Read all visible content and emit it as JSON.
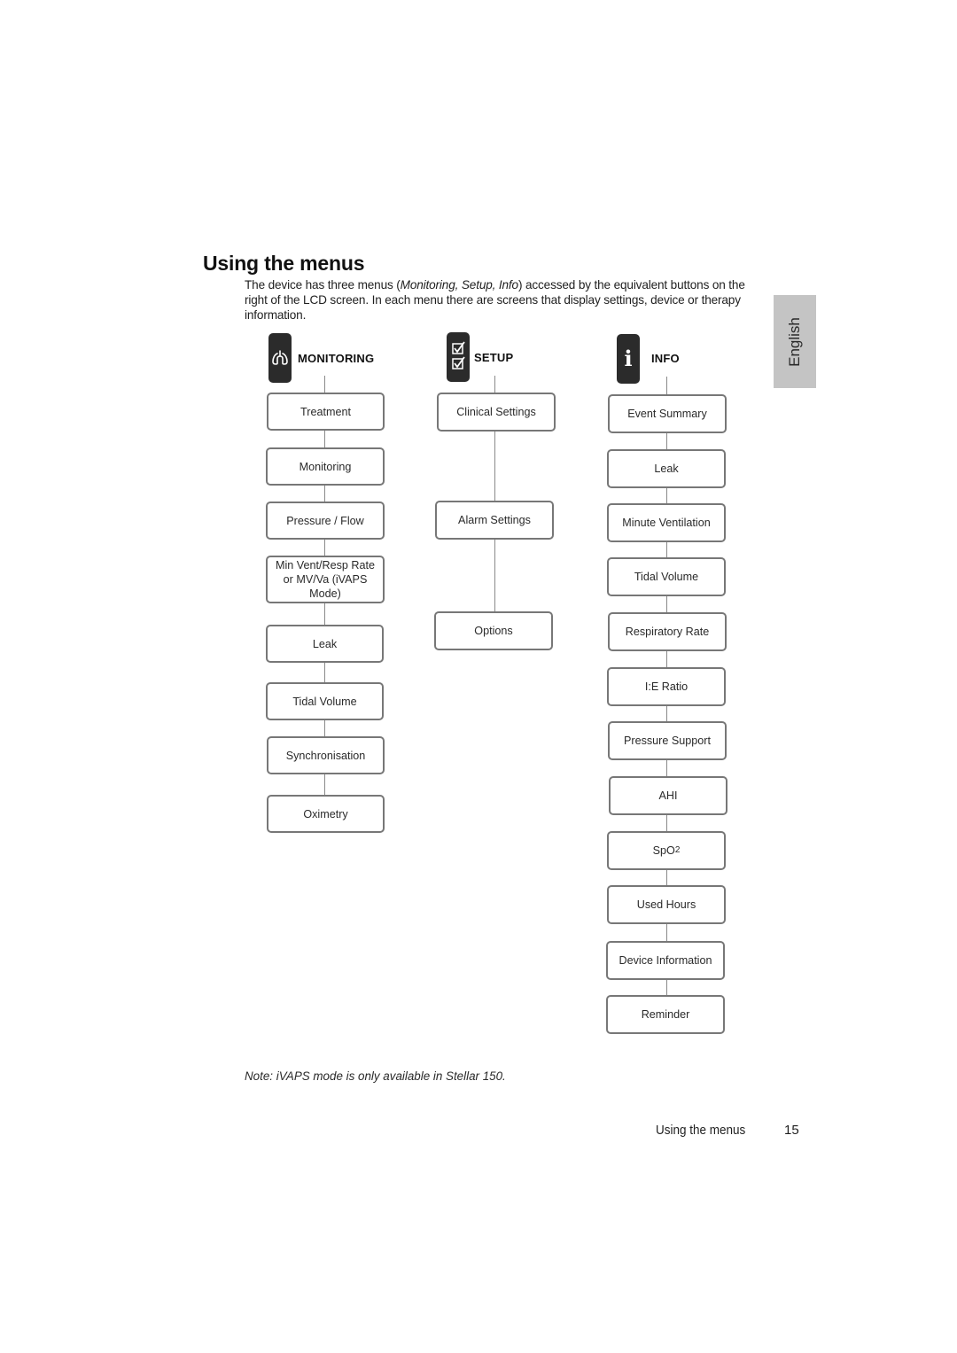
{
  "page": {
    "title": "Using the menus",
    "intro": {
      "part1": "The device has three menus (",
      "italic": "Monitoring, Setup, Info",
      "part2": ") accessed by the equivalent buttons on the right of the LCD screen. In each menu there are screens that display settings, device or therapy information."
    },
    "language_tab": "English",
    "note": "Note: iVAPS mode is only available in Stellar 150.",
    "footer": {
      "section": "Using the menus",
      "page_number": "15"
    }
  },
  "menus": {
    "monitoring": {
      "label": "MONITORING",
      "icon": "lungs-icon",
      "items": [
        "Treatment",
        "Monitoring",
        "Pressure / Flow",
        "Min Vent/Resp Rate or MV/Va (iVAPS Mode)",
        "Leak",
        "Tidal Volume",
        "Synchronisation",
        "Oximetry"
      ]
    },
    "setup": {
      "label": "SETUP",
      "icon": "checklist-icon",
      "items": [
        "Clinical Settings",
        "Alarm Settings",
        "Options"
      ]
    },
    "info": {
      "label": "INFO",
      "icon": "info-icon",
      "items": [
        "Event Summary",
        "Leak",
        "Minute Ventilation",
        "Tidal Volume",
        "Respiratory Rate",
        "I:E Ratio",
        "Pressure Support",
        "AHI",
        "SpO",
        "Used Hours",
        "Device Information",
        "Reminder"
      ],
      "spo2_subscript": "2"
    }
  }
}
